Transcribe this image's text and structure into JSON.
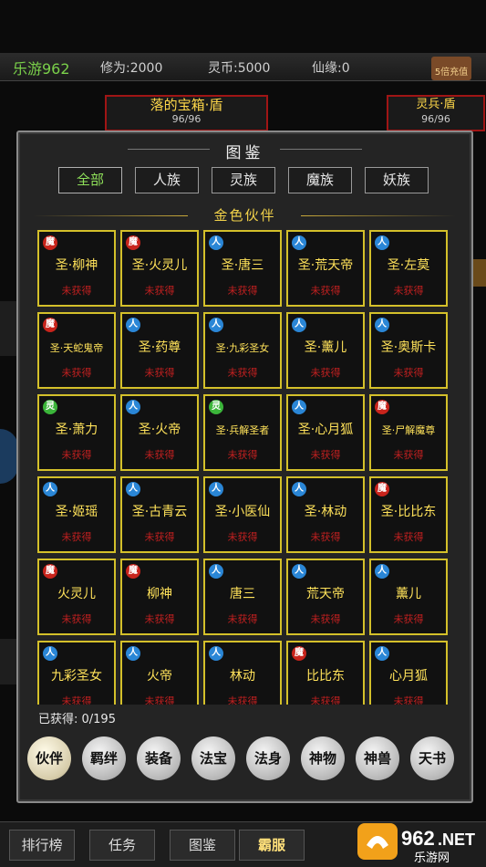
{
  "top_bar": {
    "brand": "乐游962",
    "cultivation": "修为:2000",
    "spirit_coin": "灵币:5000",
    "immortal_fate": "仙缘:0",
    "recharge_label": "5倍充值"
  },
  "background": {
    "banner_center_title": "落的宝箱·盾",
    "banner_center_value": "96/96",
    "banner_right_title": "灵兵·盾",
    "banner_right_value": "96/96",
    "bottom_nav": [
      "排行榜",
      "任务",
      "图鉴",
      "霸服"
    ],
    "logo_text": "962",
    "logo_suffix": ".NET",
    "logo_sub": "乐游网"
  },
  "panel": {
    "title": "图鉴",
    "tabs": [
      "全部",
      "人族",
      "灵族",
      "魔族",
      "妖族"
    ],
    "section_title": "金色伙伴",
    "obtained_label": "已获得: 0/195",
    "categories": [
      "伙伴",
      "羁绊",
      "装备",
      "法宝",
      "法身",
      "神物",
      "神兽",
      "天书"
    ]
  },
  "cards": [
    {
      "race": "魔",
      "name": "圣·柳神",
      "status": "未获得"
    },
    {
      "race": "魔",
      "name": "圣·火灵儿",
      "status": "未获得"
    },
    {
      "race": "人",
      "name": "圣·唐三",
      "status": "未获得"
    },
    {
      "race": "人",
      "name": "圣·荒天帝",
      "status": "未获得"
    },
    {
      "race": "人",
      "name": "圣·左莫",
      "status": "未获得"
    },
    {
      "race": "魔",
      "name": "圣·天蛇鬼帝",
      "status": "未获得"
    },
    {
      "race": "人",
      "name": "圣·药尊",
      "status": "未获得"
    },
    {
      "race": "人",
      "name": "圣·九彩圣女",
      "status": "未获得"
    },
    {
      "race": "人",
      "name": "圣·薰儿",
      "status": "未获得"
    },
    {
      "race": "人",
      "name": "圣·奥斯卡",
      "status": "未获得"
    },
    {
      "race": "灵",
      "name": "圣·萧力",
      "status": "未获得"
    },
    {
      "race": "人",
      "name": "圣·火帝",
      "status": "未获得"
    },
    {
      "race": "灵",
      "name": "圣·兵解圣者",
      "status": "未获得"
    },
    {
      "race": "人",
      "name": "圣·心月狐",
      "status": "未获得"
    },
    {
      "race": "魔",
      "name": "圣·尸解魔尊",
      "status": "未获得"
    },
    {
      "race": "人",
      "name": "圣·姬瑶",
      "status": "未获得"
    },
    {
      "race": "人",
      "name": "圣·古青云",
      "status": "未获得"
    },
    {
      "race": "人",
      "name": "圣·小医仙",
      "status": "未获得"
    },
    {
      "race": "人",
      "name": "圣·林动",
      "status": "未获得"
    },
    {
      "race": "魔",
      "name": "圣·比比东",
      "status": "未获得"
    },
    {
      "race": "魔",
      "name": "火灵儿",
      "status": "未获得"
    },
    {
      "race": "魔",
      "name": "柳神",
      "status": "未获得"
    },
    {
      "race": "人",
      "name": "唐三",
      "status": "未获得"
    },
    {
      "race": "人",
      "name": "荒天帝",
      "status": "未获得"
    },
    {
      "race": "人",
      "name": "薰儿",
      "status": "未获得"
    },
    {
      "race": "人",
      "name": "九彩圣女",
      "status": "未获得"
    },
    {
      "race": "人",
      "name": "火帝",
      "status": "未获得"
    },
    {
      "race": "人",
      "name": "林动",
      "status": "未获得"
    },
    {
      "race": "魔",
      "name": "比比东",
      "status": "未获得"
    },
    {
      "race": "人",
      "name": "心月狐",
      "status": "未获得"
    }
  ],
  "colors": {
    "card_border": "#d4c02a",
    "card_name": "#ffe25a",
    "card_status": "#c02020",
    "race_mo": "#c8241c",
    "race_ren": "#2a86d6",
    "race_ling": "#3bb53a",
    "active_tab": "#8fe05a"
  }
}
